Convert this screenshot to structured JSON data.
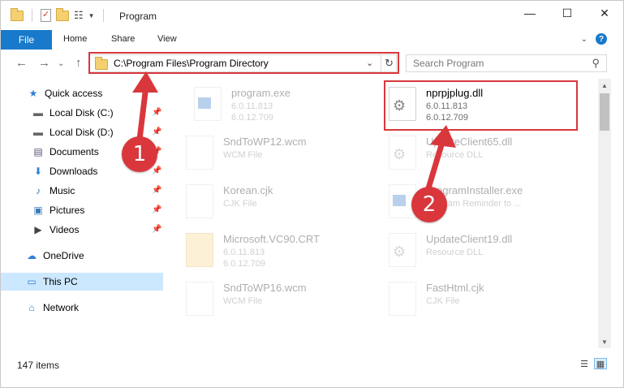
{
  "title_bar": {
    "title": "Program",
    "minimize": "—",
    "maximize": "☐",
    "close": "✕"
  },
  "ribbon": {
    "tabs": [
      "File",
      "Home",
      "Share",
      "View"
    ],
    "help": "?"
  },
  "address_bar": {
    "path": "C:\\Program Files\\Program Directory",
    "search_placeholder": "Search Program"
  },
  "sidebar": {
    "items": [
      {
        "label": "Quick access",
        "icon": "star-icon",
        "glyph": "★",
        "pinned": false
      },
      {
        "label": "Local Disk (C:)",
        "icon": "drive-icon",
        "glyph": "▬",
        "pinned": true
      },
      {
        "label": "Local Disk (D:)",
        "icon": "drive-icon",
        "glyph": "▬",
        "pinned": true
      },
      {
        "label": "Documents",
        "icon": "documents-icon",
        "glyph": "▤",
        "pinned": true
      },
      {
        "label": "Downloads",
        "icon": "download-icon",
        "glyph": "⬇",
        "pinned": true
      },
      {
        "label": "Music",
        "icon": "music-icon",
        "glyph": "♪",
        "pinned": true
      },
      {
        "label": "Pictures",
        "icon": "pictures-icon",
        "glyph": "▣",
        "pinned": true
      },
      {
        "label": "Videos",
        "icon": "videos-icon",
        "glyph": "▶",
        "pinned": true
      },
      {
        "label": "OneDrive",
        "icon": "cloud-icon",
        "glyph": "☁",
        "pinned": false
      },
      {
        "label": "This PC",
        "icon": "computer-icon",
        "glyph": "▭",
        "pinned": false,
        "selected": true
      },
      {
        "label": "Network",
        "icon": "network-icon",
        "glyph": "⌂",
        "pinned": false
      }
    ]
  },
  "files": [
    {
      "name": "program.exe",
      "line1": "6.0.11.813",
      "line2": "6.0.12.709",
      "type": "exe-icon"
    },
    {
      "name": "nprpjplug.dll",
      "line1": "6.0.11.813",
      "line2": "6.0.12.709",
      "type": "dll-icon",
      "highlighted": true
    },
    {
      "name": "SndToWP12.wcm",
      "line1": "WCM File",
      "line2": "",
      "type": "file-icon"
    },
    {
      "name": "UpdateClient65.dll",
      "line1": "Resource DLL",
      "line2": "",
      "type": "dll-icon"
    },
    {
      "name": "Korean.cjk",
      "line1": "CJK File",
      "line2": "",
      "type": "file-icon"
    },
    {
      "name": "ProgramInstaller.exe",
      "line1": "Program Reminder to ...",
      "line2": "",
      "type": "exe-icon"
    },
    {
      "name": "Microsoft.VC90.CRT",
      "line1": "6.0.11.813",
      "line2": "6.0.12.709",
      "type": "folder-icon"
    },
    {
      "name": "UpdateClient19.dll",
      "line1": "Resource DLL",
      "line2": "",
      "type": "dll-icon"
    },
    {
      "name": "SndToWP16.wcm",
      "line1": "WCM File",
      "line2": "",
      "type": "file-icon"
    },
    {
      "name": "FastHtml.cjk",
      "line1": "CJK File",
      "line2": "",
      "type": "file-icon"
    }
  ],
  "status_bar": {
    "item_count": "147 items"
  },
  "annotations": {
    "callout_1": "1",
    "callout_2": "2",
    "accent_color": "#d9373c"
  }
}
